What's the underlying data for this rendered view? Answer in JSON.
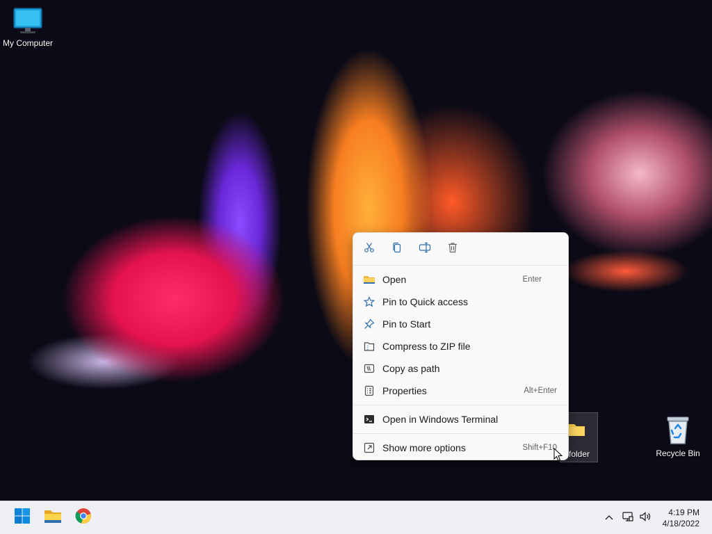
{
  "desktop": {
    "icons": [
      {
        "label": "My Computer",
        "icon": "monitor-icon"
      },
      {
        "label": "folder",
        "icon": "folder-icon"
      },
      {
        "label": "Recycle Bin",
        "icon": "recycle-bin-icon"
      }
    ]
  },
  "context_menu": {
    "toolbar": [
      {
        "name": "cut",
        "icon": "scissors-icon"
      },
      {
        "name": "copy",
        "icon": "copy-icon"
      },
      {
        "name": "rename",
        "icon": "rename-icon"
      },
      {
        "name": "delete",
        "icon": "trash-icon"
      }
    ],
    "items": [
      {
        "label": "Open",
        "shortcut": "Enter",
        "icon": "folder-open-icon"
      },
      {
        "label": "Pin to Quick access",
        "shortcut": "",
        "icon": "star-icon"
      },
      {
        "label": "Pin to Start",
        "shortcut": "",
        "icon": "pin-icon"
      },
      {
        "label": "Compress to ZIP file",
        "shortcut": "",
        "icon": "zip-icon"
      },
      {
        "label": "Copy as path",
        "shortcut": "",
        "icon": "copy-path-icon"
      },
      {
        "label": "Properties",
        "shortcut": "Alt+Enter",
        "icon": "properties-icon"
      },
      {
        "label": "Open in Windows Terminal",
        "shortcut": "",
        "icon": "terminal-icon"
      },
      {
        "label": "Show more options",
        "shortcut": "Shift+F10",
        "icon": "more-options-icon"
      }
    ]
  },
  "taskbar": {
    "apps": [
      {
        "name": "Start",
        "icon": "windows-start-icon"
      },
      {
        "name": "File Explorer",
        "icon": "file-explorer-icon"
      },
      {
        "name": "Google Chrome",
        "icon": "chrome-icon"
      }
    ],
    "tray": [
      {
        "name": "show-hidden-icons",
        "icon": "chevron-up-icon"
      },
      {
        "name": "network",
        "icon": "network-icon"
      },
      {
        "name": "volume",
        "icon": "speaker-icon"
      }
    ],
    "clock": {
      "time": "4:19 PM",
      "date": "4/18/2022"
    }
  },
  "colors": {
    "accent": "#0067c0",
    "menu_bg": "#f9f9f9",
    "taskbar_bg": "#eef0f3"
  }
}
